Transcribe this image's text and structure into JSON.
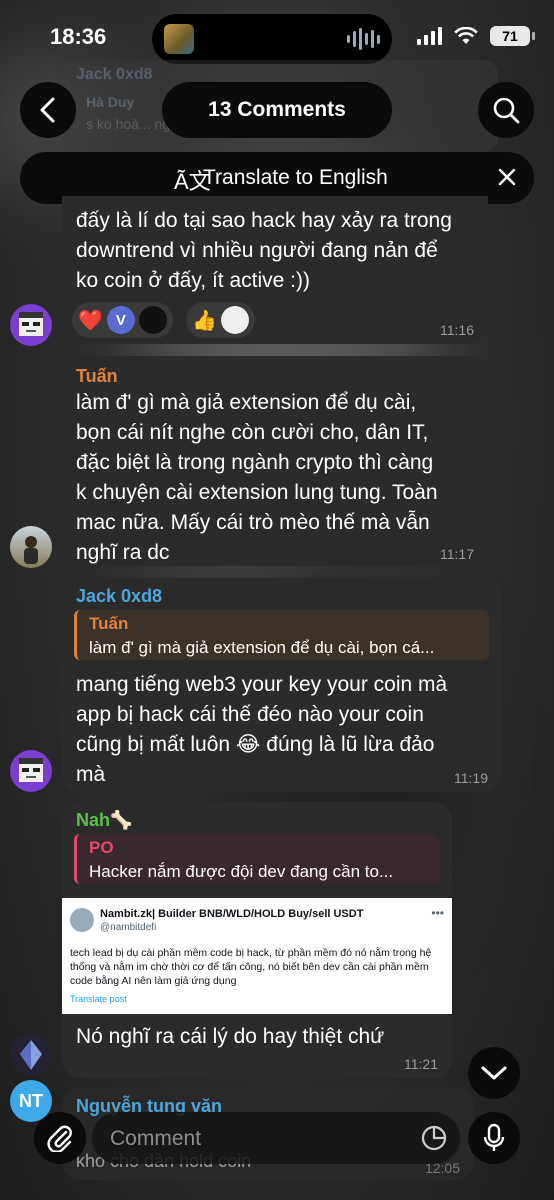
{
  "status": {
    "time": "18:36",
    "battery": "71"
  },
  "header": {
    "title": "13 Comments"
  },
  "translate": {
    "label": "Translate to English"
  },
  "ghost": {
    "name1": "Jack 0xd8",
    "name2": "Hà Duy",
    "snip": "s ko hoà... người..."
  },
  "messages": [
    {
      "text": "đấy là lí do tại sao hack hay xảy ra trong\ndowntrend vì nhiều người đang nản để\nko coin ở đấy, ít active :))",
      "time": "11:16",
      "reactions": [
        "❤️",
        "V",
        "👍"
      ]
    },
    {
      "sender": "Tuấn",
      "text": "làm đ' gì mà giả extension để dụ cài,\nbọn cái nít nghe còn cười cho, dân IT,\nđặc biệt là trong ngành crypto thì càng\nk chuyện cài extension lung tung. Toàn\nmac nữa. Mấy cái trò mèo thế mà vẫn\nnghĩ ra dc",
      "time": "11:17"
    },
    {
      "sender": "Jack 0xd8",
      "quote_name": "Tuấn",
      "quote_text": "làm đ' gì mà giả extension để dụ cài, bọn cá...",
      "text": "mang tiếng web3 your key your coin mà\napp bị hack cái thế đéo nào your coin\ncũng bị mất luôn 😂 đúng là lũ lừa đảo\nmà",
      "time": "11:19"
    },
    {
      "sender": "Nah🦴",
      "quote_name": "PO",
      "quote_text": "Hacker nắm được đội dev đang cần to...",
      "tweet": {
        "name": "Nambit.zk| Builder BNB/WLD/HOLD Buy/sell USDT",
        "handle": "@nambitdefi",
        "body": "tech lead bị dụ cài phần mềm code bị hack, từ phần mềm đó nó nằm trong hệ thống và nằm im chờ thời cơ để tấn công, nó biết bên dev cần cài phần mềm code bằng AI nên làm giả ứng dụng",
        "link": "Translate post"
      },
      "text": "Nó nghĩ ra cái lý do hay thiệt chứ",
      "time": "11:21"
    },
    {
      "sender": "Nguyễn tung văn",
      "avatar_initials": "NT",
      "text": "khó cho dân hold coin",
      "time": "12:05"
    }
  ],
  "input": {
    "placeholder": "Comment"
  },
  "colors": {
    "tuan": "#e0833a",
    "jack": "#4ea6d8",
    "nah": "#5cc04c",
    "po": "#e24a6a",
    "nt": "#3ea8e8"
  }
}
